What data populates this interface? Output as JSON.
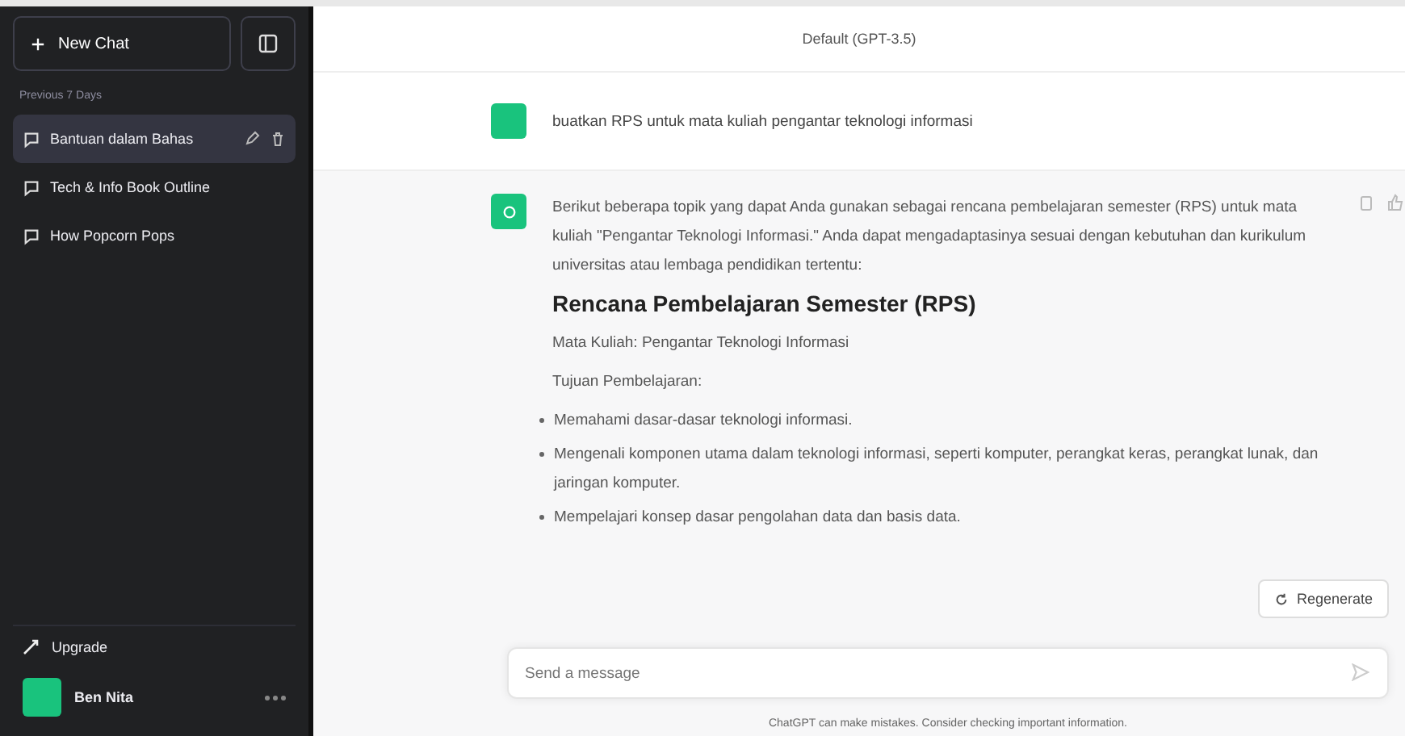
{
  "sidebar": {
    "new_chat": "New Chat",
    "section": "Previous 7 Days",
    "items": [
      {
        "title": "Bantuan dalam Bahas",
        "selected": true
      },
      {
        "title": "Tech & Info Book Outline",
        "selected": false
      },
      {
        "title": "How Popcorn Pops",
        "selected": false
      }
    ],
    "upgrade": "Upgrade",
    "user": "Ben Nita"
  },
  "header": {
    "model": "Default (GPT-3.5)"
  },
  "messages": [
    {
      "kind": "user",
      "text": "buatkan RPS untuk mata kuliah pengantar teknologi informasi"
    },
    {
      "kind": "assistant",
      "intro": "Berikut beberapa topik yang dapat Anda gunakan sebagai rencana pembelajaran semester (RPS) untuk mata kuliah \"Pengantar Teknologi Informasi.\" Anda dapat mengadaptasinya sesuai dengan kebutuhan dan kurikulum universitas atau lembaga pendidikan tertentu:",
      "heading": "Rencana Pembelajaran Semester (RPS)",
      "course": "Mata Kuliah: Pengantar Teknologi Informasi",
      "goals_title": "Tujuan Pembelajaran:",
      "bullets": [
        "Memahami dasar-dasar teknologi informasi.",
        "Mengenali komponen utama dalam teknologi informasi, seperti komputer, perangkat keras, perangkat lunak, dan jaringan komputer.",
        "Mempelajari konsep dasar pengolahan data dan basis data."
      ]
    }
  ],
  "regenerate": "Regenerate",
  "composer": {
    "placeholder": "Send a message"
  },
  "footer": "ChatGPT can make mistakes. Consider checking important information."
}
